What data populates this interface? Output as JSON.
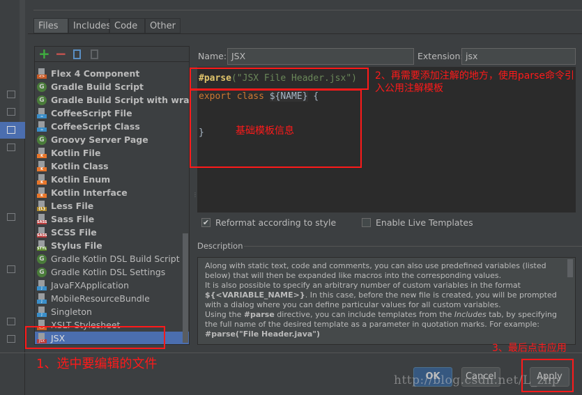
{
  "tabs": [
    "Files",
    "Includes",
    "Code",
    "Other"
  ],
  "toolbar": {
    "add": "+",
    "remove": "−"
  },
  "templates": [
    {
      "label": "Flex 4 Component",
      "bold": true,
      "icon": "file",
      "tag": "<>",
      "color": "#c75a26"
    },
    {
      "label": "Gradle Build Script",
      "bold": true,
      "icon": "gradle"
    },
    {
      "label": "Gradle Build Script with wrapper",
      "bold": true,
      "icon": "gradle"
    },
    {
      "label": "CoffeeScript File",
      "bold": true,
      "icon": "file",
      "tag": "☕",
      "color": "#3a8ec9"
    },
    {
      "label": "CoffeeScript Class",
      "bold": true,
      "icon": "file",
      "tag": "☕",
      "color": "#3a8ec9"
    },
    {
      "label": "Groovy Server Page",
      "bold": true,
      "icon": "gradle"
    },
    {
      "label": "Kotlin File",
      "bold": true,
      "icon": "file",
      "tag": "K",
      "color": "#e8762b"
    },
    {
      "label": "Kotlin Class",
      "bold": true,
      "icon": "file",
      "tag": "K",
      "color": "#e8762b"
    },
    {
      "label": "Kotlin Enum",
      "bold": true,
      "icon": "file",
      "tag": "K",
      "color": "#e8762b"
    },
    {
      "label": "Kotlin Interface",
      "bold": true,
      "icon": "file",
      "tag": "K",
      "color": "#e8762b"
    },
    {
      "label": "Less File",
      "bold": true,
      "icon": "file",
      "tag": "{L}",
      "color": "#b08a2a"
    },
    {
      "label": "Sass File",
      "bold": true,
      "icon": "file",
      "tag": "SASS",
      "color": "#b83b3b"
    },
    {
      "label": "SCSS File",
      "bold": true,
      "icon": "file",
      "tag": "SASS",
      "color": "#b83b3b"
    },
    {
      "label": "Stylus File",
      "bold": true,
      "icon": "file",
      "tag": "STYL",
      "color": "#5c8a2a"
    },
    {
      "label": "Gradle Kotlin DSL Build Script",
      "bold": false,
      "icon": "gradle"
    },
    {
      "label": "Gradle Kotlin DSL Settings",
      "bold": false,
      "icon": "gradle"
    },
    {
      "label": "JavaFXApplication",
      "bold": false,
      "icon": "file",
      "tag": "J",
      "color": "#3a8ec9"
    },
    {
      "label": "MobileResourceBundle",
      "bold": false,
      "icon": "file",
      "tag": "J",
      "color": "#3a8ec9"
    },
    {
      "label": "Singleton",
      "bold": false,
      "icon": "file",
      "tag": "J",
      "color": "#3a8ec9"
    },
    {
      "label": "XSLT Stylesheet",
      "bold": false,
      "icon": "file",
      "tag": "<>",
      "color": "#c75a26"
    },
    {
      "label": "JSX",
      "bold": false,
      "icon": "file",
      "tag": "JSX",
      "color": "#b83b3b",
      "selected": true
    }
  ],
  "form": {
    "name_label": "Name:",
    "name_value": "JSX",
    "ext_label": "Extension:",
    "ext_value": "jsx"
  },
  "editor": {
    "parse_kw": "#parse",
    "parse_arg": "(\"JSX File Header.jsx\")",
    "line2_kw": "export class ",
    "line2_var": "${NAME}",
    "line2_end": " {",
    "line3": "}"
  },
  "options": {
    "reformat": "Reformat according to style",
    "reformat_checked": true,
    "live": "Enable Live Templates",
    "live_checked": false
  },
  "description": {
    "title": "Description",
    "p1": "Along with static text, code and comments, you can also use predefined variables (listed below) that will then be expanded like macros into the corresponding values.",
    "p2a": "It is also possible to specify an arbitrary number of custom variables in the format ",
    "p2b": "${<VARIABLE_NAME>}",
    "p2c": ". In this case, before the new file is created, you will be prompted with a dialog where you can define particular values for all custom variables.",
    "p3a": "Using the ",
    "p3b": "#parse",
    "p3c": " directive, you can include templates from the ",
    "p3d": "Includes",
    "p3e": " tab, by specifying the full name of the desired template as a parameter in quotation marks. For example:",
    "p4": "#parse(\"File Header.java\")"
  },
  "buttons": {
    "ok": "OK",
    "cancel": "Cancel",
    "apply": "Apply"
  },
  "annotations": {
    "a1": "1、选中要编辑的文件",
    "a2": "2、再需要添加注解的地方，使用parse命令引入公用注解模板",
    "a_base": "基础模板信息",
    "a3": "3、最后点击应用"
  },
  "watermark": "http://blog.csdn.net/L_zhp",
  "colors": {
    "accent": "#4b6eaf",
    "annotation": "#ff1a1a"
  }
}
